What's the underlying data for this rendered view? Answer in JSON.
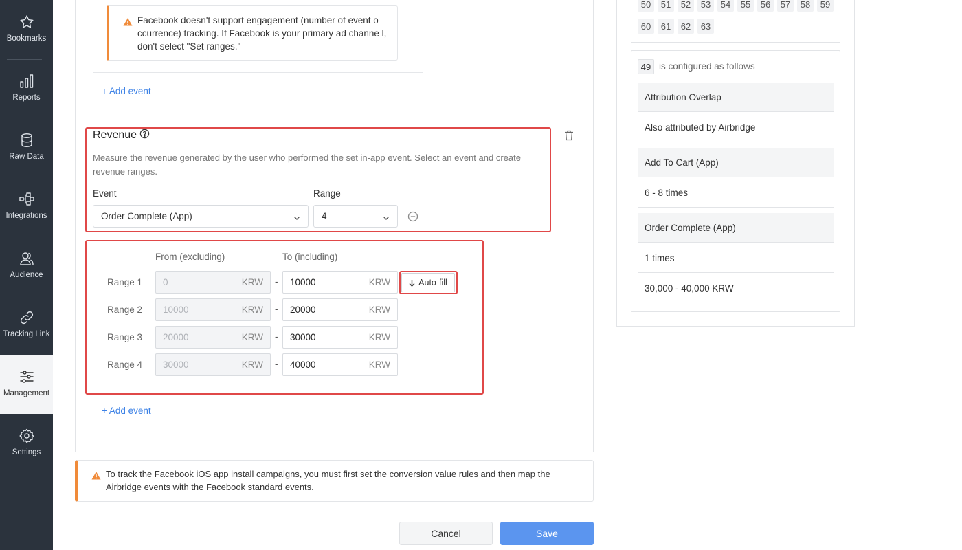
{
  "sidebar": {
    "items": [
      {
        "label": "Bookmarks",
        "icon": "star-icon"
      },
      {
        "label": "Reports",
        "icon": "bar-chart-icon"
      },
      {
        "label": "Raw Data",
        "icon": "database-icon"
      },
      {
        "label": "Integrations",
        "icon": "integrations-icon"
      },
      {
        "label": "Audience",
        "icon": "audience-icon"
      },
      {
        "label": "Tracking Link",
        "icon": "link-icon"
      },
      {
        "label": "Management",
        "icon": "sliders-icon",
        "active": true
      },
      {
        "label": "Settings",
        "icon": "gear-icon"
      }
    ]
  },
  "engagement": {
    "facebook_warning": "Facebook doesn't support engagement (number of event o ccurrence) tracking. If Facebook is your primary ad channe l, don't select \"Set ranges.\"",
    "add_event": "+ Add event"
  },
  "revenue": {
    "title": "Revenue",
    "description": "Measure the revenue generated by the user who performed the set in-app event. Select an event and create revenue ranges.",
    "event_label": "Event",
    "event_value": "Order Complete (App)",
    "range_label": "Range",
    "range_value": "4",
    "from_header": "From (excluding)",
    "to_header": "To (including)",
    "currency": "KRW",
    "dash": "-",
    "autofill_label": "Auto-fill",
    "ranges": [
      {
        "label": "Range 1",
        "from": "0",
        "to": "10000"
      },
      {
        "label": "Range 2",
        "from": "10000",
        "to": "20000"
      },
      {
        "label": "Range 3",
        "from": "20000",
        "to": "30000"
      },
      {
        "label": "Range 4",
        "from": "30000",
        "to": "40000"
      }
    ],
    "add_event": "+ Add event"
  },
  "page_warning": "To track the Facebook iOS app install campaigns, you must first set the conversion value rules and then map the Airbridge events with the Facebook standard events.",
  "buttons": {
    "cancel": "Cancel",
    "save": "Save"
  },
  "right_panel": {
    "numbers_row1": [
      "50",
      "51",
      "52",
      "53",
      "54",
      "55",
      "56",
      "57",
      "58",
      "59"
    ],
    "numbers_row2": [
      "60",
      "61",
      "62",
      "63"
    ],
    "selected_value": "49",
    "configured_text": "is configured as follows",
    "rows": [
      {
        "text": "Attribution Overlap",
        "grey": true
      },
      {
        "text": "Also attributed by Airbridge",
        "grey": false
      },
      {
        "text": "Add To Cart (App)",
        "grey": true
      },
      {
        "text": "6 - 8 times",
        "grey": false
      },
      {
        "text": "Order Complete (App)",
        "grey": true
      },
      {
        "text": "1 times",
        "grey": false
      },
      {
        "text": "30,000 - 40,000 KRW",
        "grey": false
      }
    ]
  },
  "colors": {
    "accent": "#3d82e6",
    "warning": "#f08b3a",
    "highlight": "#e04848",
    "sidebar": "#2b333d",
    "save": "#5b95ef"
  }
}
